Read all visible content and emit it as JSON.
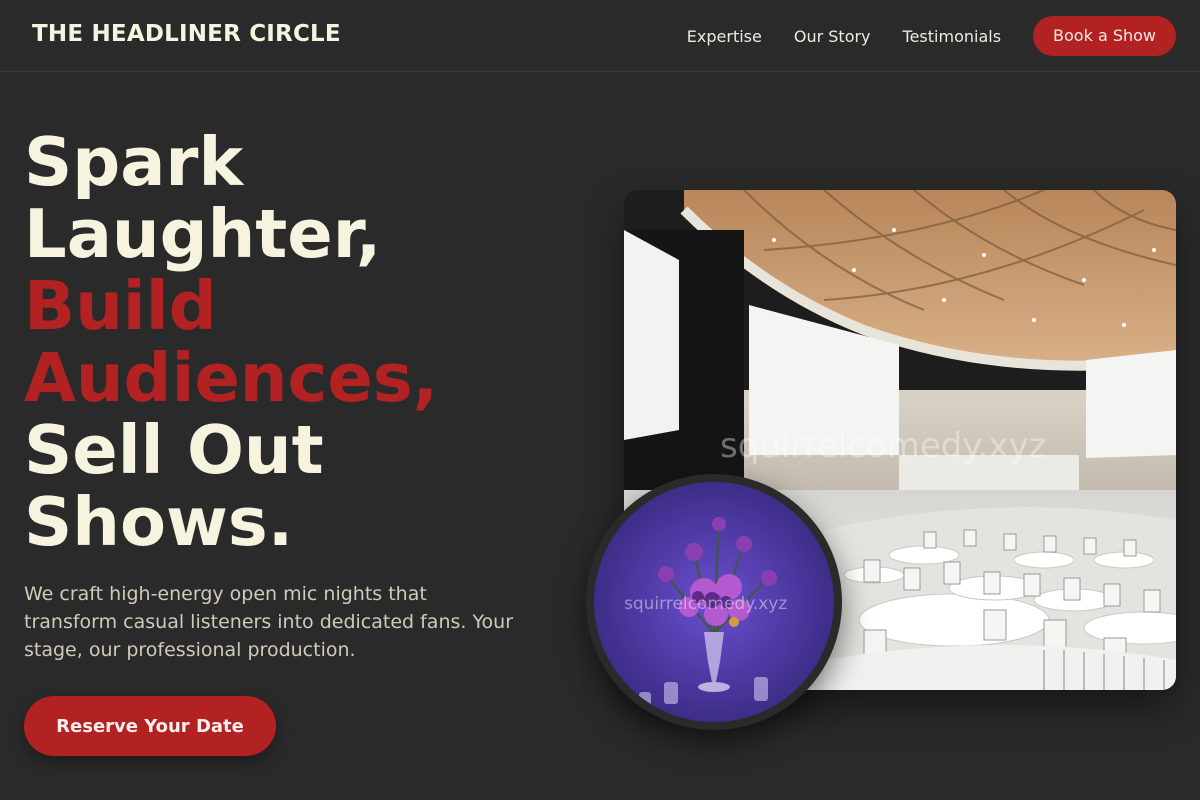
{
  "header": {
    "brand": "THE HEADLINER CIRCLE",
    "nav": [
      "Expertise",
      "Our Story",
      "Testimonials"
    ],
    "cta": "Book a Show"
  },
  "hero": {
    "headline_lines": [
      "Spark",
      "Laughter,",
      "Build",
      "Audiences,",
      "Sell Out",
      "Shows."
    ],
    "subtext": "We craft high-energy open mic nights that transform casual listeners into dedicated fans. Your stage, our professional production.",
    "cta": "Reserve Your Date"
  },
  "images": {
    "venue_watermark": "squirrelcomedy.xyz",
    "centerpiece_watermark": "squirrelcomedy.xyz"
  },
  "colors": {
    "background": "#2a2a2a",
    "accent": "#b22222",
    "cream": "#f6f3df"
  }
}
